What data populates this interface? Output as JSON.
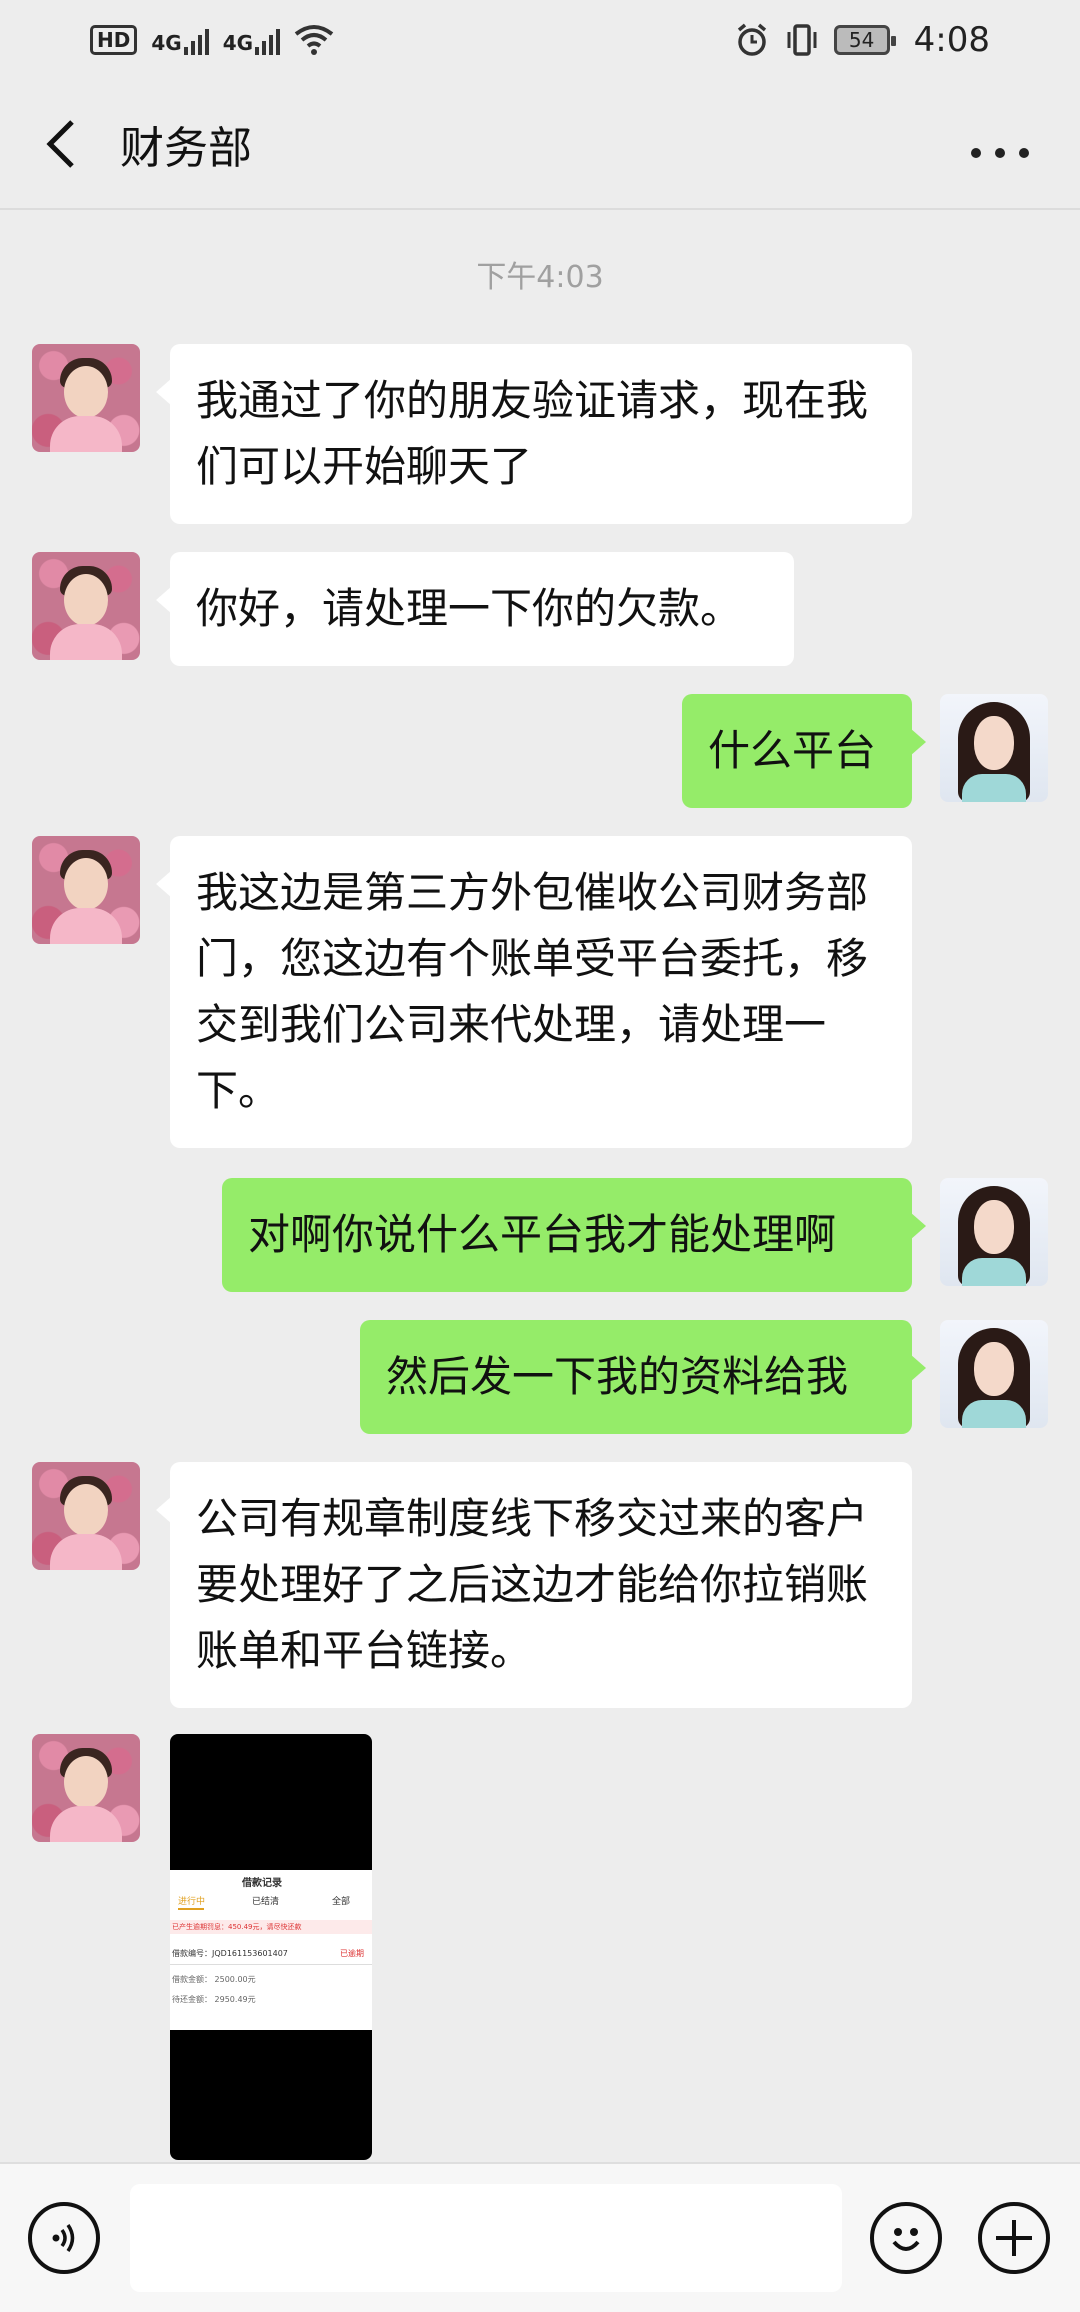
{
  "status_bar": {
    "hd_label": "HD",
    "net1": "4G",
    "net2": "4G",
    "battery": "54",
    "time": "4:08"
  },
  "header": {
    "title": "财务部"
  },
  "chat": {
    "timestamp": "下午4:03",
    "messages": [
      {
        "side": "left",
        "text": "我通过了你的朋友验证请求，现在我们可以开始聊天了"
      },
      {
        "side": "left",
        "text": "你好，请处理一下你的欠款。"
      },
      {
        "side": "right",
        "text": "什么平台"
      },
      {
        "side": "left",
        "text": "我这边是第三方外包催收公司财务部门，您这边有个账单受平台委托，移交到我们公司来代处理，请处理一下。"
      },
      {
        "side": "right",
        "text": "对啊你说什么平台我才能处理啊"
      },
      {
        "side": "right",
        "text": "然后发一下我的资料给我"
      },
      {
        "side": "left",
        "text": "公司有规章制度线下移交过来的客户要处理好了之后这边才能给你拉销账账单和平台链接。"
      }
    ],
    "image_message": {
      "title": "借款记录",
      "tabs": [
        "进行中",
        "已结清",
        "全部"
      ],
      "notice": "已产生逾期罚息：450.49元，请尽快还款",
      "loan_no": "借款编号：JQD161153601407",
      "status": "已逾期",
      "amount": "借款金额：   2500.00元",
      "pending": "待还金额：   2950.49元"
    }
  },
  "input": {
    "placeholder": ""
  }
}
